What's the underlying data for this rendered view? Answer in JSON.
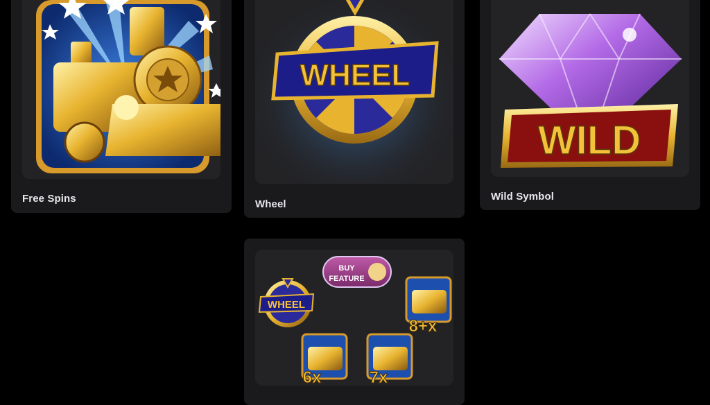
{
  "cards": [
    {
      "label": "Free Spins"
    },
    {
      "label": "Wheel"
    },
    {
      "label": "Wild Symbol"
    },
    {
      "label": ""
    }
  ],
  "art": {
    "wheel_text": "WHEEL",
    "wild_text": "WILD",
    "buy_feature_line1": "BUY",
    "buy_feature_line2": "FEATURE",
    "multipliers": [
      "8+x",
      "6x",
      "7x"
    ]
  },
  "colors": {
    "page_bg": "#000000",
    "card_bg": "#1a1a1c",
    "thumb_bg": "#232326",
    "gold": "#e8b430",
    "wheel_blue": "#2a2a9a",
    "wild_red": "#8a1010",
    "gem_purple": "#a64ad8",
    "buy_purple": "#9a3c86"
  }
}
